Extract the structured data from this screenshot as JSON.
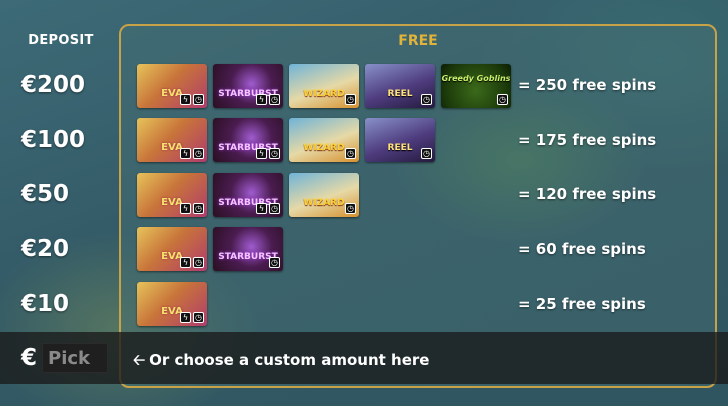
{
  "header": {
    "deposit_label": "DEPOSIT",
    "free_label": "FREE"
  },
  "tiers": [
    {
      "amount": "€200",
      "spins": "= 250 free spins",
      "games": [
        "EVA",
        "STARBURST",
        "WIZARD",
        "REEL",
        "Greedy Goblins"
      ]
    },
    {
      "amount": "€100",
      "spins": "= 175 free spins",
      "games": [
        "EVA",
        "STARBURST",
        "WIZARD",
        "REEL"
      ]
    },
    {
      "amount": "€50",
      "spins": "= 120 free spins",
      "games": [
        "EVA",
        "STARBURST",
        "WIZARD"
      ]
    },
    {
      "amount": "€20",
      "spins": "= 60 free spins",
      "games": [
        "EVA",
        "STARBURST"
      ]
    },
    {
      "amount": "€10",
      "spins": "= 25 free spins",
      "games": [
        "EVA"
      ]
    }
  ],
  "custom": {
    "currency": "€",
    "placeholder": "Pick",
    "text": "Or choose a custom amount here",
    "arrow_icon": "arrow-left-icon"
  },
  "colors": {
    "accent": "#e2b339",
    "panel_border": "#c7a246"
  }
}
